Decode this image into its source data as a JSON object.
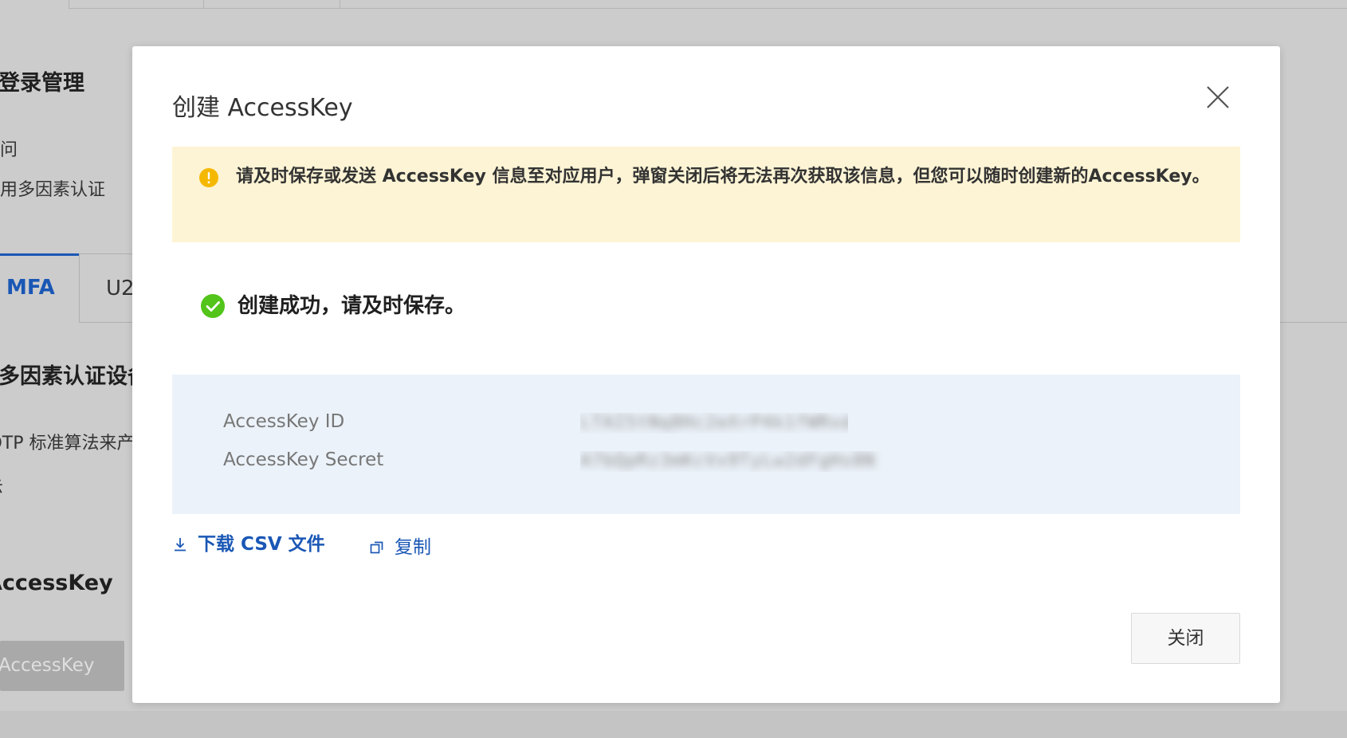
{
  "background": {
    "section_login": "登录管理",
    "item_access": "访问",
    "item_mfa_setting": "启用多因素认证",
    "tabs": [
      {
        "label": "MFA",
        "active": true
      },
      {
        "label": "U2",
        "active": false
      }
    ],
    "section_mfa_device": "多因素认证设备",
    "mfa_desc": "TOTP 标准算法来产",
    "mfa_desc2": "示",
    "section_accesskey": "AccessKey",
    "create_button": "AccessKey"
  },
  "modal": {
    "title": "创建 AccessKey",
    "close_icon": "close-icon",
    "warning": {
      "icon": "warning-circle-icon",
      "text": "请及时保存或发送 AccessKey 信息至对应用户，弹窗关闭后将无法再次获取该信息，但您可以随时创建新的AccessKey。",
      "color": "#fdf4d5"
    },
    "success": {
      "icon": "check-circle-icon",
      "text": "创建成功，请及时保存。",
      "color": "#52c41a"
    },
    "keys": [
      {
        "label": "AccessKey ID",
        "value": "LTAI5tNq8Hc2eXrP4k1fWRxd"
      },
      {
        "label": "AccessKey Secret",
        "value": "A7bQpRz3mKcVx9TyLw2dFgHs8N"
      }
    ],
    "actions": {
      "download": {
        "label": "下载 CSV 文件",
        "icon": "download-icon"
      },
      "copy": {
        "label": "复制",
        "icon": "copy-icon"
      }
    },
    "close_button": "关闭",
    "accent_color": "#1a57b5"
  }
}
